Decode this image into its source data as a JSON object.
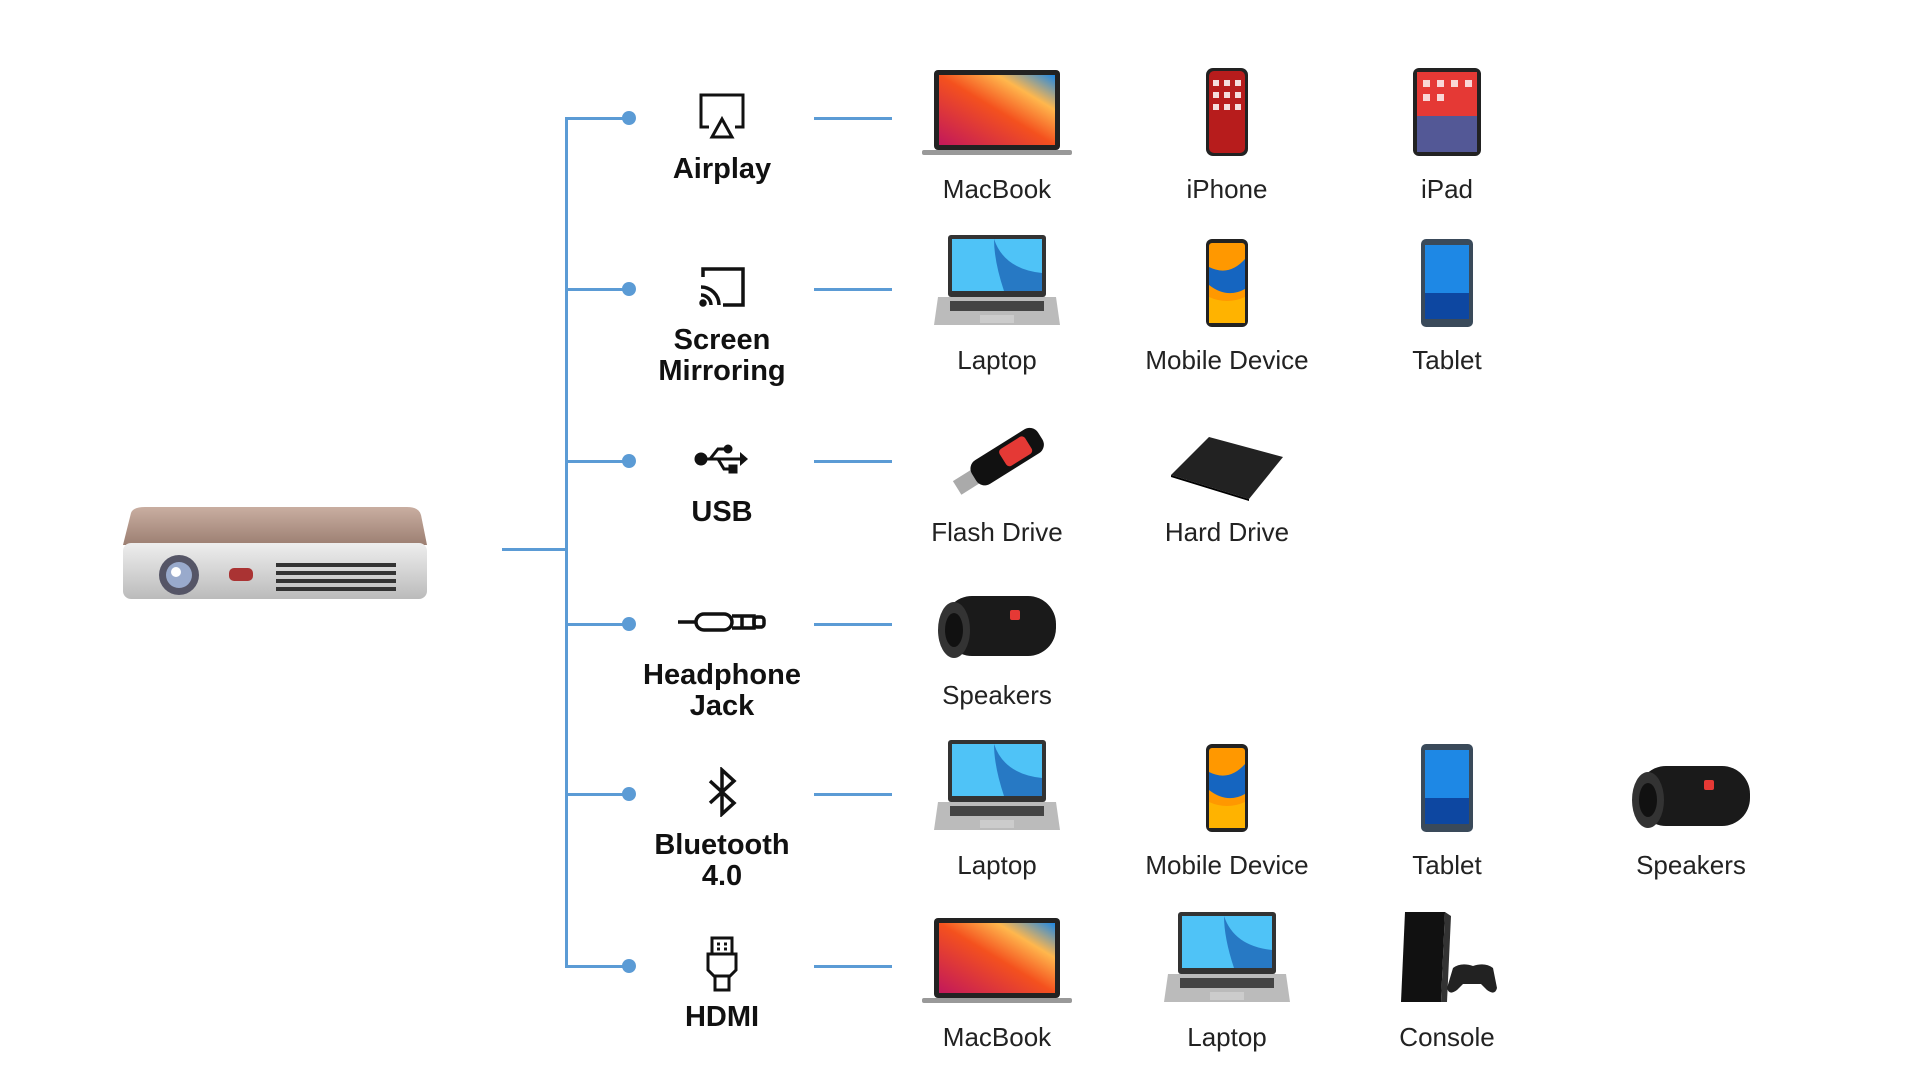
{
  "accent_color": "#5b9bd5",
  "hub": {
    "name": "projector",
    "icon": "projector-image"
  },
  "rows": [
    {
      "label": "Airplay",
      "icon": "airplay-icon",
      "devices": [
        {
          "label": "MacBook",
          "icon": "macbook"
        },
        {
          "label": "iPhone",
          "icon": "iphone"
        },
        {
          "label": "iPad",
          "icon": "ipad"
        }
      ]
    },
    {
      "label": "Screen\nMirroring",
      "icon": "cast-icon",
      "devices": [
        {
          "label": "Laptop",
          "icon": "laptop"
        },
        {
          "label": "Mobile Device",
          "icon": "phone"
        },
        {
          "label": "Tablet",
          "icon": "tablet"
        }
      ]
    },
    {
      "label": "USB",
      "icon": "usb-icon",
      "devices": [
        {
          "label": "Flash Drive",
          "icon": "flash-drive"
        },
        {
          "label": "Hard Drive",
          "icon": "hard-drive"
        }
      ]
    },
    {
      "label": "Headphone\nJack",
      "icon": "audio-jack-icon",
      "devices": [
        {
          "label": "Speakers",
          "icon": "speaker"
        }
      ]
    },
    {
      "label": "Bluetooth\n4.0",
      "icon": "bluetooth-icon",
      "devices": [
        {
          "label": "Laptop",
          "icon": "laptop"
        },
        {
          "label": "Mobile Device",
          "icon": "phone"
        },
        {
          "label": "Tablet",
          "icon": "tablet"
        },
        {
          "label": "Speakers",
          "icon": "speaker"
        }
      ]
    },
    {
      "label": "HDMI",
      "icon": "hdmi-icon",
      "devices": [
        {
          "label": "MacBook",
          "icon": "macbook"
        },
        {
          "label": "Laptop",
          "icon": "laptop"
        },
        {
          "label": "Console",
          "icon": "console"
        }
      ]
    }
  ]
}
